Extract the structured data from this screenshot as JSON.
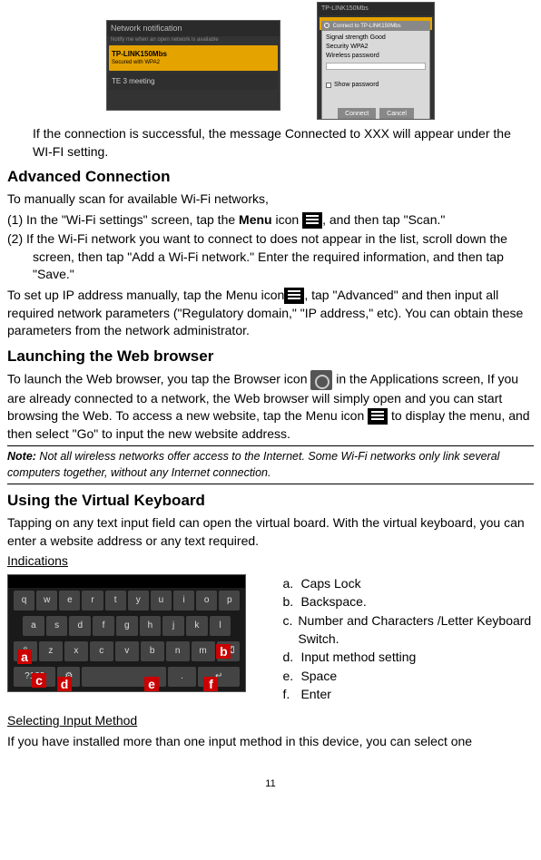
{
  "topShot1": {
    "bar": "Network notification",
    "barSub": "Notify me when an open network is available",
    "row1": "TP-LINK150Mbs",
    "row1sub": "Secured with WPA2",
    "row2": "TE 3 meeting"
  },
  "topShot2": {
    "bar": "TP-LINK150Mbs",
    "dlgHeader": "Connect to TP-LINK150Mbs",
    "sig": "Signal strength  Good",
    "sec": "Security  WPA2",
    "pass": "Wireless password",
    "show": "Show password",
    "btnConnect": "Connect",
    "btnCancel": "Cancel"
  },
  "p1": "If the connection is successful, the message Connected to XXX will appear under the WI-FI setting.",
  "h_advanced": "Advanced Connection",
  "p2": "To manually scan for available Wi-Fi networks,",
  "step1a": "(1) In the \"Wi-Fi settings\" screen, tap the ",
  "step1b": "Menu",
  "step1c": " icon ",
  "step1d": ", and then tap \"Scan.\"",
  "step2": "(2) If the Wi-Fi network you want to connect to does not appear in the list, scroll down the screen, then tap \"Add a Wi-Fi network.\" Enter the required information, and then tap \"Save.\"",
  "p3a": "To set up IP address manually, tap the Menu icon",
  "p3b": ", tap \"Advanced\" and then input all required network parameters (\"Regulatory domain,\" \"IP address,\" etc). You can obtain these parameters from the network administrator.",
  "h_launch": "Launching the Web browser",
  "p4a": "To launch the Web browser, you tap the Browser icon ",
  "p4b": " in the Applications screen, If you are already connected to a network, the Web browser will simply open and you can start browsing the Web. To access a new website, tap the Menu icon ",
  "p4c": " to display the menu, and then select \"Go\" to input the new website address.",
  "note": "Note:",
  "noteBody": " Not all wireless networks offer access to the Internet. Some Wi-Fi networks only link several computers together, without any Internet connection.",
  "h_vk": "Using the Virtual Keyboard",
  "p5": "Tapping on any text input field can open the virtual board. With the virtual keyboard, you can enter a website address or any text required.",
  "indications": "Indications",
  "kb": {
    "r1": [
      "q",
      "w",
      "e",
      "r",
      "t",
      "y",
      "u",
      "i",
      "o",
      "p"
    ],
    "r2": [
      "a",
      "s",
      "d",
      "f",
      "g",
      "h",
      "j",
      "k",
      "l"
    ],
    "r3": [
      "⇧",
      "z",
      "x",
      "c",
      "v",
      "b",
      "n",
      "m",
      "⌫"
    ],
    "r4": [
      "?123",
      "",
      "",
      "",
      "",
      ".",
      "↵"
    ]
  },
  "markers": {
    "a": "a",
    "b": "b",
    "c": "c",
    "d": "d",
    "e": "e",
    "f": "f"
  },
  "legend": {
    "a": "Caps Lock",
    "b": "Backspace.",
    "c": "Number and Characters /Letter Keyboard Switch.",
    "d": "Input method setting",
    "e": "Space",
    "f": "Enter"
  },
  "h_select": "Selecting Input Method",
  "p6": "If you have installed more than one input method in this device, you can select one",
  "pageNum": "11"
}
